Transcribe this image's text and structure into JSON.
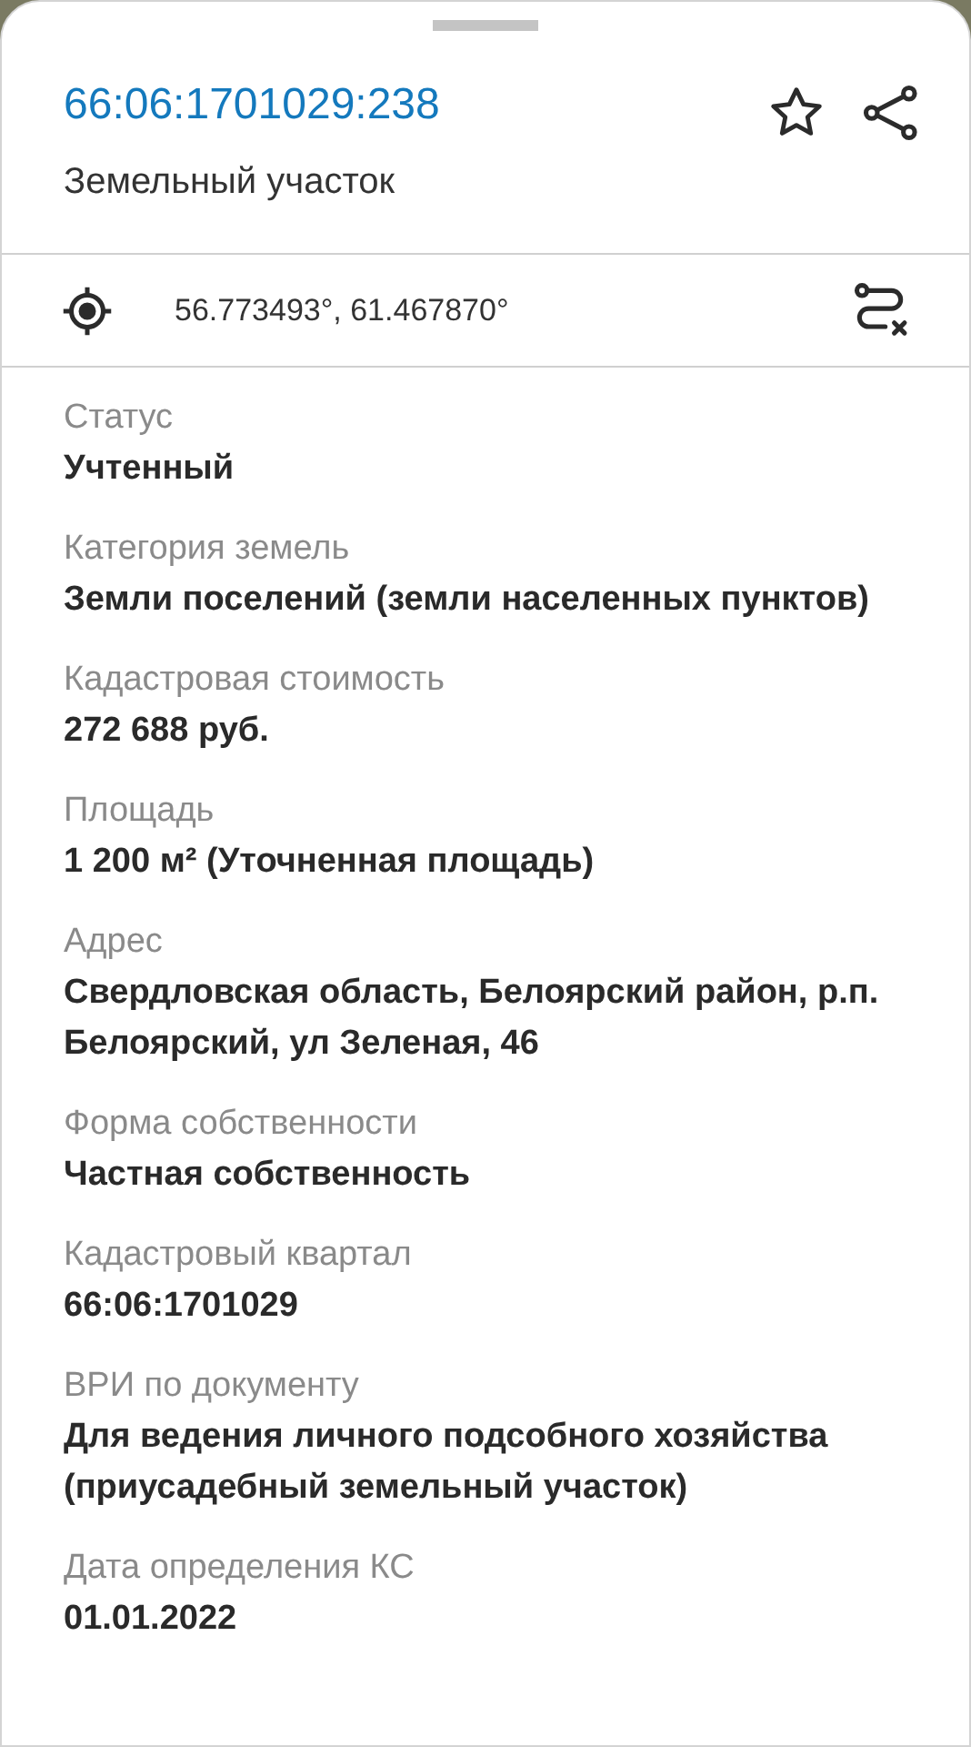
{
  "header": {
    "title": "66:06:1701029:238",
    "subtitle": "Земельный участок"
  },
  "coordinates": "56.773493°, 61.467870°",
  "fields": [
    {
      "label": "Статус",
      "value": "Учтенный"
    },
    {
      "label": "Категория земель",
      "value": "Земли поселений (земли населенных пунктов)"
    },
    {
      "label": "Кадастровая стоимость",
      "value": "272 688 руб."
    },
    {
      "label": "Площадь",
      "value": "1 200 м² (Уточненная площадь)"
    },
    {
      "label": "Адрес",
      "value": "Свердловская область, Белоярский район, р.п. Белоярский, ул Зеленая, 46"
    },
    {
      "label": "Форма собственности",
      "value": "Частная собственность"
    },
    {
      "label": "Кадастровый квартал",
      "value": "66:06:1701029"
    },
    {
      "label": "ВРИ по документу",
      "value": "Для ведения личного подсобного хозяйства (приусадебный земельный участок)"
    },
    {
      "label": "Дата определения КС",
      "value": "01.01.2022"
    }
  ]
}
